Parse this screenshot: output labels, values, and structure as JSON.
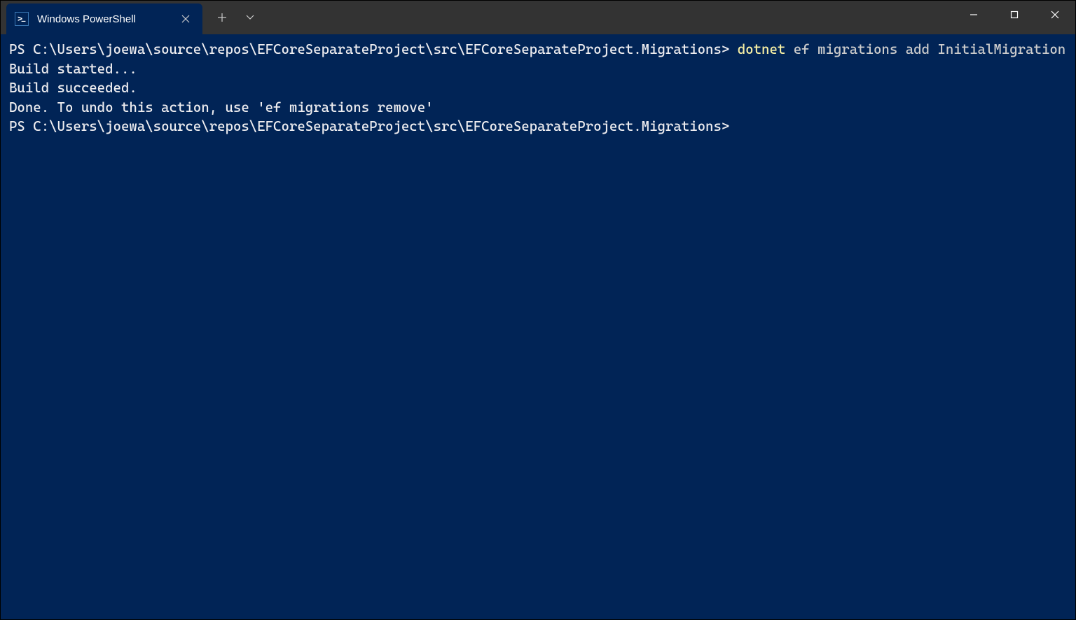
{
  "tab": {
    "title": "Windows PowerShell"
  },
  "terminal": {
    "line1_prompt": "PS C:\\Users\\joewa\\source\\repos\\EFCoreSeparateProject\\src\\EFCoreSeparateProject.Migrations> ",
    "line1_cmd_part1": "dotnet",
    "line1_cmd_part2": " ef migrations add InitialMigration",
    "line2": "Build started...",
    "line3": "Build succeeded.",
    "line4": "Done. To undo this action, use 'ef migrations remove'",
    "line5_prompt": "PS C:\\Users\\joewa\\source\\repos\\EFCoreSeparateProject\\src\\EFCoreSeparateProject.Migrations>"
  }
}
